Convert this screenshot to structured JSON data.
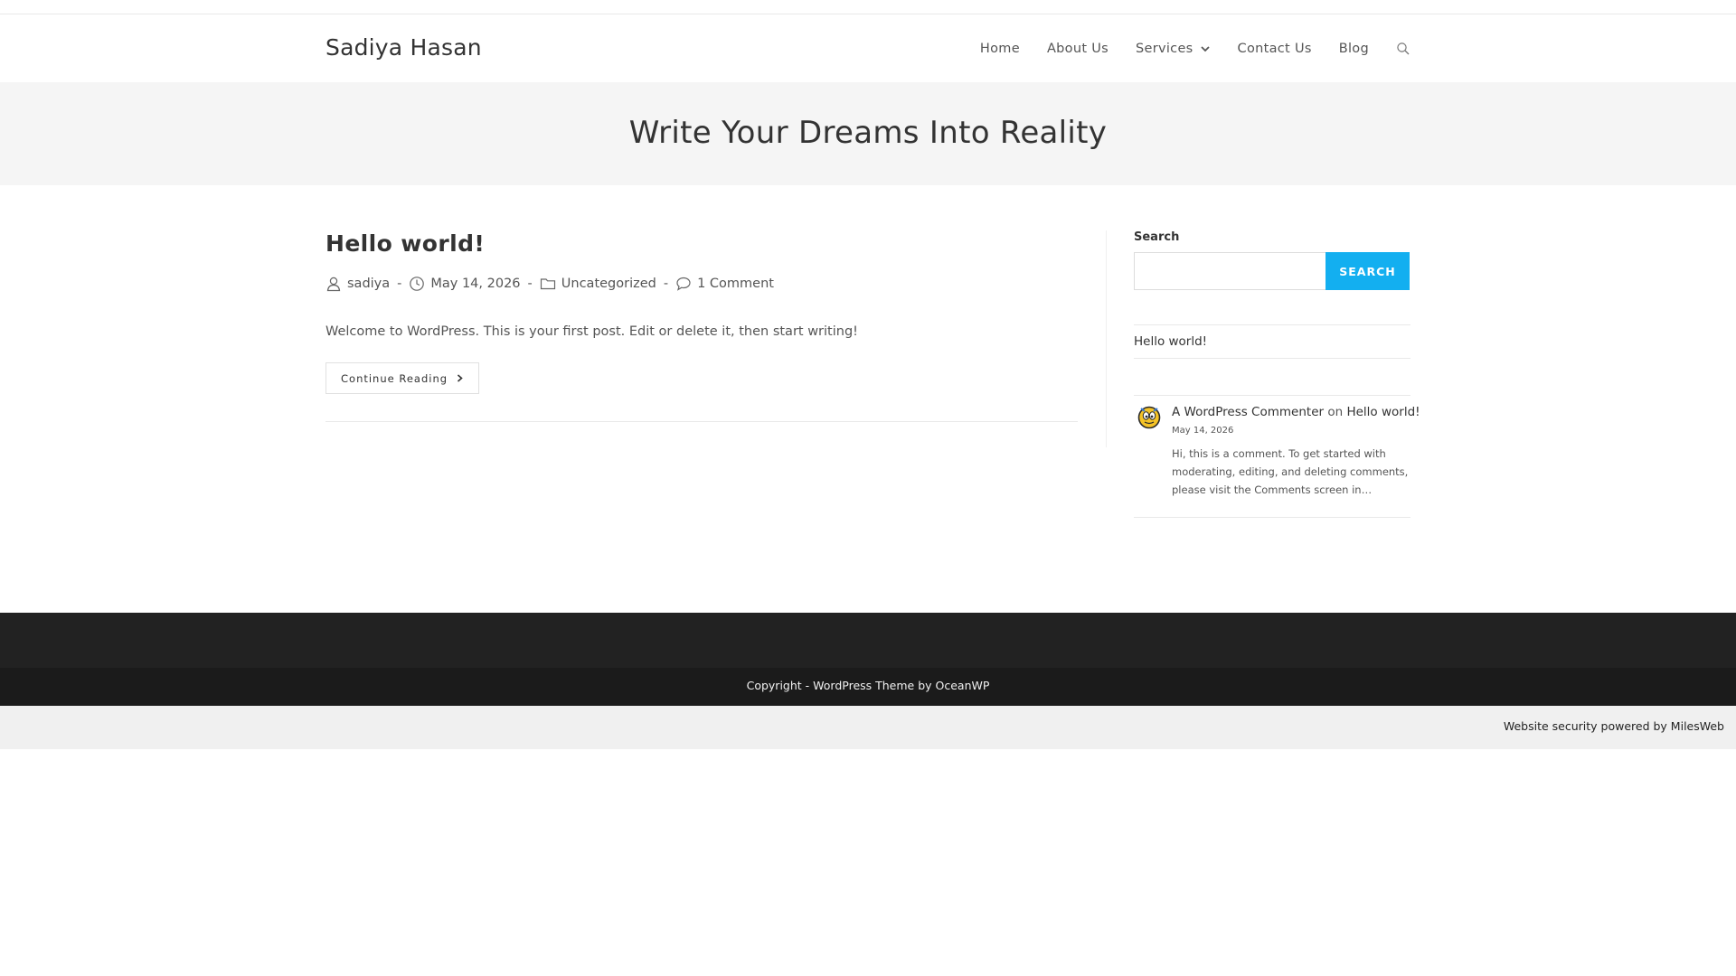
{
  "site": {
    "title": "Sadiya Hasan"
  },
  "nav": {
    "items": [
      {
        "label": "Home"
      },
      {
        "label": "About Us"
      },
      {
        "label": "Services"
      },
      {
        "label": "Contact Us"
      },
      {
        "label": "Blog"
      }
    ]
  },
  "page_header": {
    "title": "Write Your Dreams Into Reality"
  },
  "post": {
    "title": "Hello world!",
    "author": "sadiya",
    "date": "May 14, 2026",
    "category": "Uncategorized",
    "comments": "1 Comment",
    "meta_separator": "-",
    "excerpt": "Welcome to WordPress. This is your first post. Edit or delete it, then start writing!",
    "continue_label": "Continue Reading"
  },
  "sidebar": {
    "search_label": "Search",
    "search_value": "",
    "search_button": "SEARCH",
    "recent_posts": [
      {
        "title": "Hello world!"
      }
    ],
    "recent_comment": {
      "author": "A WordPress Commenter",
      "on": "on",
      "post": "Hello world!",
      "date": "May 14, 2026",
      "text": "Hi, this is a comment. To get started with moderating, editing, and deleting comments, please visit the Comments screen in…"
    }
  },
  "footer": {
    "copyright": "Copyright - WordPress Theme by OceanWP",
    "security": "Website security powered by MilesWeb"
  },
  "colors": {
    "accent": "#13aff0",
    "page_header_bg": "#f5f5f5",
    "footer_bg": "#222222",
    "footer_bottom_bg": "#1b1b1b"
  }
}
